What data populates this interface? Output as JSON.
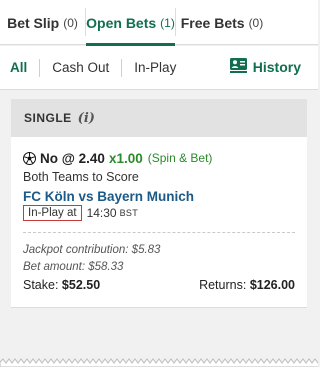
{
  "tabs": [
    {
      "label": "Bet Slip",
      "count": "(0)"
    },
    {
      "label": "Open Bets",
      "count": "(1)"
    },
    {
      "label": "Free Bets",
      "count": "(0)"
    }
  ],
  "filters": {
    "all": "All",
    "cash_out": "Cash Out",
    "in_play": "In-Play",
    "history": "History"
  },
  "bet": {
    "type_label": "SINGLE",
    "info_glyph": "i",
    "selection": "No @ 2.40",
    "multiplier": "x1.00",
    "tag": "(Spin & Bet)",
    "market": "Both Teams to Score",
    "event": "FC Köln vs Bayern Munich",
    "inplay_badge": "In-Play at",
    "time": "14:30",
    "timezone": "BST",
    "jackpot": "Jackpot contribution: $5.83",
    "bet_amount": "Bet amount: $58.33",
    "stake_label": "Stake:",
    "stake_value": "$52.50",
    "returns_label": "Returns:",
    "returns_value": "$126.00"
  },
  "colors": {
    "accent": "#126e51",
    "odds_green": "#2c8a2c",
    "event_blue": "#1b5a86",
    "inplay_border": "#c83a3a"
  }
}
